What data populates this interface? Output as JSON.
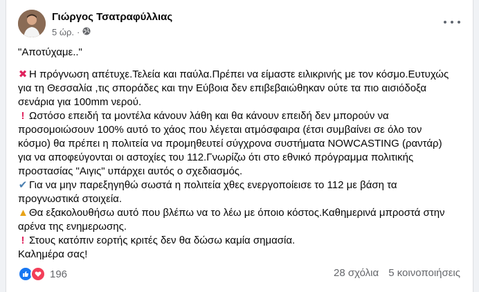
{
  "post": {
    "author": "Γιώργος Τσατραφύλλιας",
    "time": "5 ώρ.",
    "body": {
      "quote": "\"Αποτύχαμε..\"",
      "lines": [
        "Η πρόγνωση απέτυχε.Τελεία και παύλα.Πρέπει να είμαστε ειλικρινής με τον κόσμο.Ευτυχώς",
        "για τη Θεσσαλία ,τις σποράδες και την Εύβοια δεν επιβεβαιώθηκαν ούτε τα πιο αισιόδοξα",
        "σενάρια για 100mm νερού.",
        "Ωστόσο επειδή τα μοντέλα κάνουν λάθη και θα κάνουν επειδή δεν μπορούν να",
        "προσομοιώσουν 100% αυτό το χάος που λέγεται ατμόσφαιρα (έτσι συμβαίνει σε όλο τον",
        "κόσμο)  θα πρέπει η πολιτεία να προμηθευτεί σύγχρονα συστήματα NOWCASTING (ραντάρ)",
        "για να αποφεύγονται οι αστοχίες του 112.Γνωρίζω ότι στο εθνικό πρόγραμμα πολιτικής",
        "προστασίας  \"Αιγις\" υπάρχει αυτός ο σχεδιασμός.",
        "Για να μην παρεξηγηθώ σωστά η πολιτεία χθες ενεργοποίεισε το 112 με βάση τα",
        "προγνωστικά στοιχεία.",
        "Θα εξακολουθήσω αυτό που βλέπω να το λέω με όποιο κόστος.Καθημερινά μπροστά στην",
        "αρένα της ενημερωσης.",
        "Στους κατόπιν εορτής κριτές δεν θα δώσω καμία σημασία.",
        "Καλημέρα σας!"
      ]
    },
    "reactions_count": "196",
    "comments": "28 σχόλια",
    "shares": "5 κοινοποιήσεις"
  }
}
